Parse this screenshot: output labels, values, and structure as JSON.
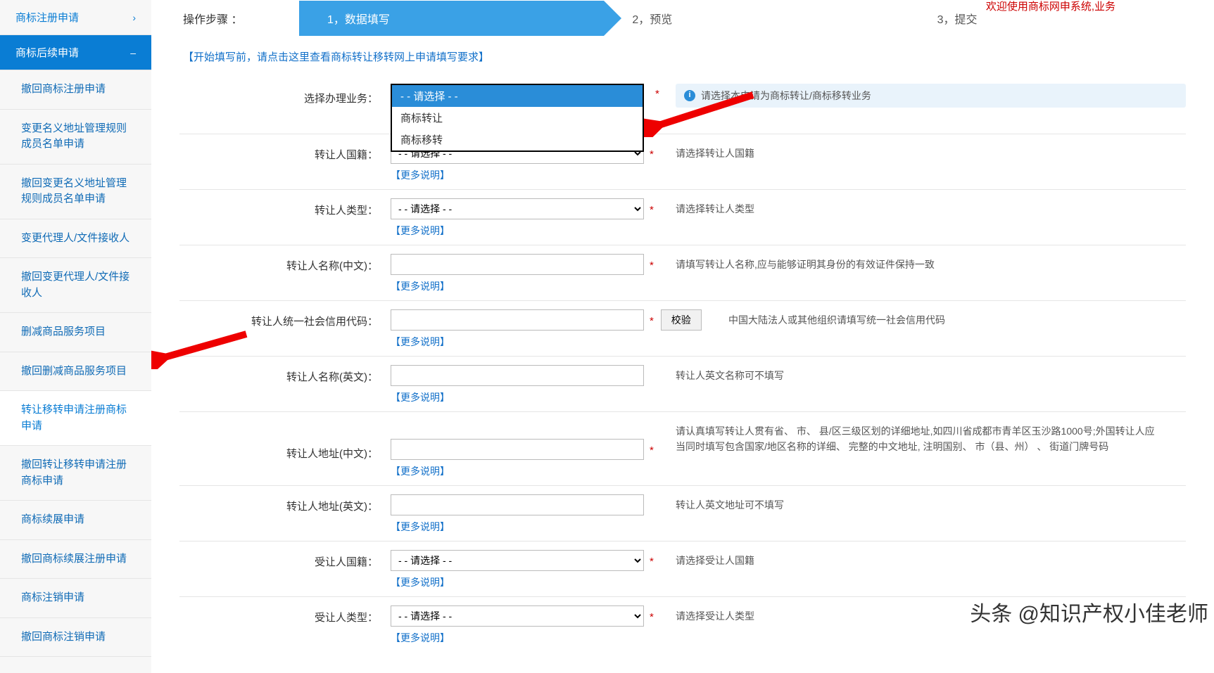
{
  "sidebar": {
    "group1": "商标注册申请",
    "group2": "商标后续申请",
    "items": [
      "撤回商标注册申请",
      "变更名义地址管理规则成员名单申请",
      "撤回变更名义地址管理规则成员名单申请",
      "变更代理人/文件接收人",
      "撤回变更代理人/文件接收人",
      "删减商品服务项目",
      "撤回删减商品服务项目",
      "转让移转申请注册商标申请",
      "撤回转让移转申请注册商标申请",
      "商标续展申请",
      "撤回商标续展注册申请",
      "商标注销申请",
      "撤回商标注销申请"
    ]
  },
  "header": {
    "welcome": "欢迎使用商标网申系统,业务",
    "steps_label": "操作步骤  ：",
    "step1": "1，数据填写",
    "step2": "2，预览",
    "step3": "3，提交"
  },
  "top_link": "【开始填写前，请点击这里查看商标转让移转网上申请填写要求】",
  "dropdown": {
    "opt_placeholder": "-  - 请选择 -  -",
    "opt1": "商标转让",
    "opt2": "商标移转"
  },
  "more": "【更多说明】",
  "verify_btn": "校验",
  "fields": {
    "biz": {
      "label": "选择办理业务：",
      "hint_info": "请选择本申请为商标转让/商标移转业务"
    },
    "nat": {
      "label": "转让人国籍：",
      "hint": "请选择转让人国籍",
      "placeholder": "-  - 请选择 -  -"
    },
    "type": {
      "label": "转让人类型：",
      "hint": "请选择转让人类型",
      "placeholder": "-  - 请选择 -  -"
    },
    "name_cn": {
      "label": "转让人名称(中文)：",
      "hint": "请填写转让人名称,应与能够证明其身份的有效证件保持一致"
    },
    "credit": {
      "label": "转让人统一社会信用代码：",
      "hint": "中国大陆法人或其他组织请填写统一社会信用代码"
    },
    "name_en": {
      "label": "转让人名称(英文)：",
      "hint": "转让人英文名称可不填写"
    },
    "addr_cn": {
      "label": "转让人地址(中文)：",
      "hint": "请认真填写转让人贯有省、 市、 县/区三级区划的详细地址,如四川省成都市青羊区玉沙路1000号;外国转让人应当同时填写包含国家/地区名称的详细、 完整的中文地址,  注明国别、 市（县、州） 、 街道门牌号码"
    },
    "addr_en": {
      "label": "转让人地址(英文)：",
      "hint": "转让人英文地址可不填写"
    },
    "assignee_nat": {
      "label": "受让人国籍：",
      "hint": "请选择受让人国籍",
      "placeholder": "-  - 请选择 -  -"
    },
    "assignee_type": {
      "label": "受让人类型：",
      "hint": "请选择受让人类型",
      "placeholder": "-  - 请选择 -  -"
    }
  },
  "watermark": "头条 @知识产权小佳老师"
}
